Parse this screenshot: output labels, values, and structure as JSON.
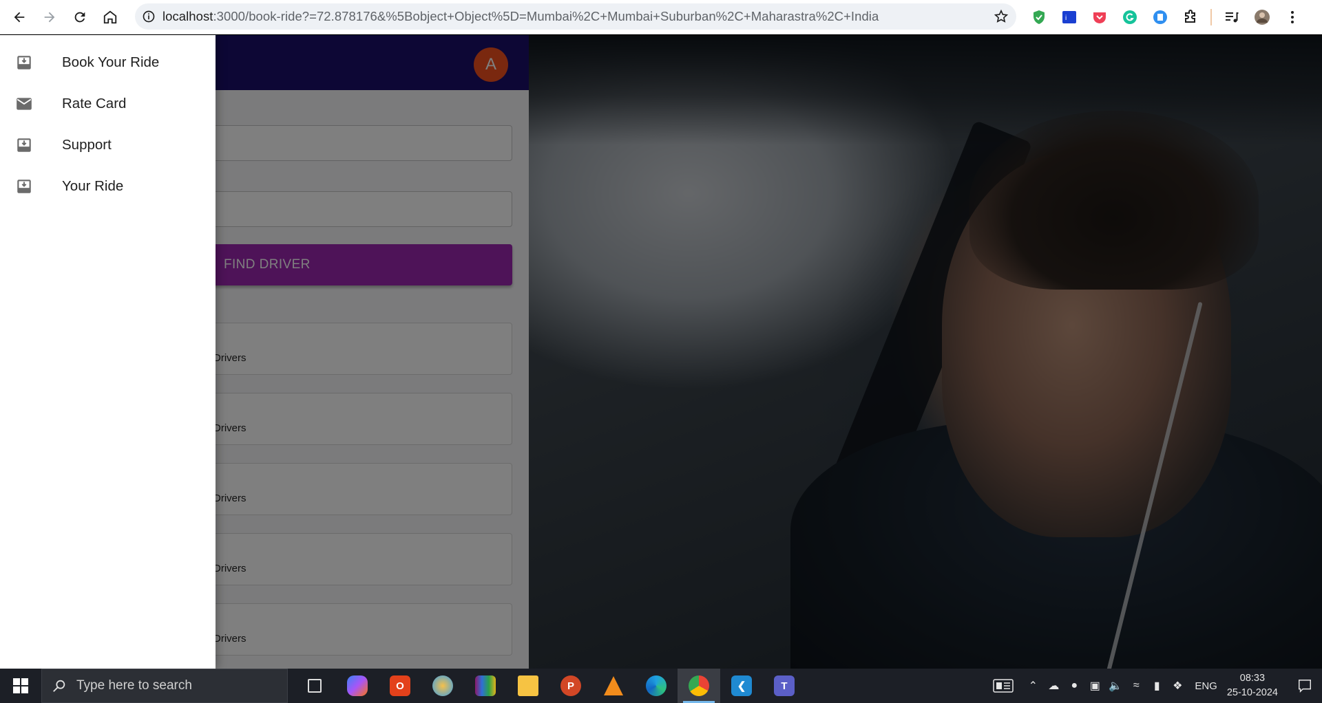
{
  "browser": {
    "url_host": "localhost",
    "url_rest": ":3000/book-ride?=72.878176&%5Bobject+Object%5D=Mumbai%2C+Mumbai+Suburban%2C+Maharastra%2C+India"
  },
  "app": {
    "avatar_letter": "A",
    "find_driver_label": "FIND DRIVER",
    "cards": [
      {
        "text": "Drivers"
      },
      {
        "text": "Drivers"
      },
      {
        "text": "Drivers"
      },
      {
        "text": "Drivers"
      },
      {
        "text": "Drivers"
      }
    ],
    "colors": {
      "appbar": "#1b0f6b",
      "button": "#9c27b0",
      "avatar": "#f4511e"
    }
  },
  "drawer": {
    "items": [
      {
        "label": "Book Your Ride",
        "icon": "inbox-download-icon"
      },
      {
        "label": "Rate Card",
        "icon": "mail-icon"
      },
      {
        "label": "Support",
        "icon": "inbox-download-icon"
      },
      {
        "label": "Your Ride",
        "icon": "inbox-download-icon"
      }
    ]
  },
  "taskbar": {
    "search_placeholder": "Type here to search",
    "language": "ENG",
    "time": "08:33",
    "date": "25-10-2024",
    "apps": [
      "task-view",
      "copilot",
      "office",
      "paint",
      "winrar",
      "file-explorer",
      "powerpoint",
      "vlc",
      "edge",
      "chrome",
      "vscode",
      "teams"
    ]
  }
}
